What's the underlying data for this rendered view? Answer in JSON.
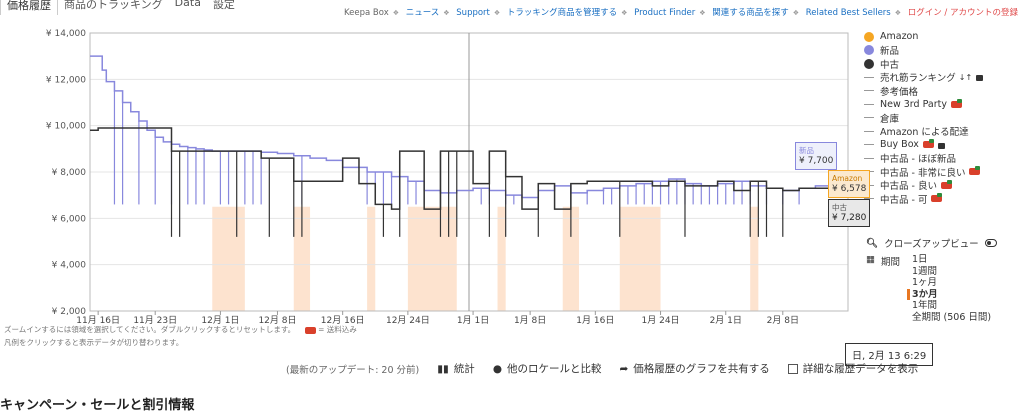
{
  "tabs": [
    "価格履歴",
    "商品のトラッキング",
    "Data",
    "設定"
  ],
  "toplinks": {
    "items": [
      "Keepa Box",
      "ニュース",
      "Support",
      "トラッキング商品を管理する",
      "Product Finder",
      "関連する商品を探す",
      "Related Best Sellers"
    ],
    "login": "ログイン / アカウントの登録"
  },
  "legend": {
    "amazon": "Amazon",
    "new": "新品",
    "used": "中古",
    "sales_rank": "売れ筋ランキング",
    "sales_rank_icon": "↓↑",
    "reference": "参考価格",
    "new3p": "New 3rd Party",
    "warehouse": "倉庫",
    "fba": "Amazon による配達",
    "buybox": "Buy Box",
    "used_like_new": "中古品 - ほぼ新品",
    "used_very_good": "中古品 - 非常に良い",
    "used_good": "中古品 - 良い",
    "used_acceptable": "中古品 - 可"
  },
  "closeup": {
    "label": "クローズアップビュー",
    "icon": "search-icon"
  },
  "period": {
    "label": "期間",
    "icon": "calendar-icon",
    "options": [
      "1日",
      "1週間",
      "1ヶ月",
      "3か月",
      "1年間",
      "全期間 (506 日間)"
    ],
    "selected": "3か月"
  },
  "notes": {
    "line1": "ズームインするには領域を選択してください。ダブルクリックするとリセットします。",
    "shipping": "= 送料込み",
    "line2": "凡例をクリックすると表示データが切り替わります。"
  },
  "hover_date": "日, 2月 13 6:29",
  "bottom": {
    "updated": "(最新のアップデート: 20 分前)",
    "stats": "統計",
    "compare": "他のロケールと比較",
    "share": "価格履歴のグラフを共有する",
    "details": "詳細な履歴データを表示"
  },
  "footer_title": "キャンペーン・セールと割引情報",
  "colors": {
    "amazon": "#f5a623",
    "new": "#8888dd",
    "used": "#333333",
    "buybox_band": "#fde3cf",
    "axis": "#bbbbbb"
  },
  "chart_data": {
    "type": "line",
    "ylim": [
      2000,
      14000
    ],
    "y_ticks": [
      "¥ 2,000",
      "¥ 4,000",
      "¥ 6,000",
      "¥ 8,000",
      "¥ 10,000",
      "¥ 12,000",
      "¥ 14,000"
    ],
    "y_tick_values": [
      2000,
      4000,
      6000,
      8000,
      10000,
      12000,
      14000
    ],
    "x_ticks": [
      "11月 16日",
      "11月 23日",
      "12月 1日",
      "12月 8日",
      "12月 16日",
      "12月 24日",
      "1月 1日",
      "1月 8日",
      "1月 16日",
      "1月 24日",
      "2月 1日",
      "2月 8日"
    ],
    "x_tick_values": [
      0,
      7,
      15,
      22,
      30,
      38,
      46,
      53,
      61,
      69,
      77,
      84
    ],
    "x_range": [
      -1,
      92
    ],
    "crosshair_x": 45.5,
    "series": [
      {
        "name": "新品",
        "color": "#8888dd",
        "x": [
          -1,
          0,
          0.5,
          1,
          2,
          3,
          4,
          5,
          6,
          7,
          8,
          9,
          10,
          11,
          12,
          13,
          14,
          16,
          18,
          20,
          22,
          24,
          26,
          28,
          30,
          33,
          36,
          38,
          40,
          42,
          44,
          46,
          48,
          50,
          52,
          54,
          56,
          58,
          60,
          62,
          64,
          66,
          68,
          70,
          72,
          74,
          76,
          78,
          80,
          82,
          84,
          86,
          88,
          90,
          92
        ],
        "y": [
          13000,
          13000,
          12400,
          11900,
          11500,
          11000,
          10600,
          10200,
          9800,
          9500,
          9300,
          9200,
          9100,
          9050,
          9000,
          8950,
          8900,
          8900,
          8900,
          8850,
          8800,
          8700,
          8600,
          8500,
          8200,
          8000,
          7800,
          7600,
          7200,
          7100,
          7200,
          7300,
          7200,
          7000,
          6900,
          7200,
          7400,
          7100,
          7200,
          7300,
          7400,
          7500,
          7600,
          7700,
          7500,
          7400,
          7500,
          7600,
          7400,
          7300,
          7200,
          7300,
          7400,
          7700,
          7700
        ],
        "spikes": [
          2,
          3,
          5,
          7,
          9,
          11,
          12,
          13,
          15,
          16,
          18,
          19,
          20,
          25,
          33,
          34,
          35,
          36,
          37,
          38,
          39,
          40,
          47,
          48,
          50,
          51,
          58,
          60,
          62,
          63,
          65,
          66,
          67,
          68,
          69,
          70,
          71,
          72,
          73,
          74,
          75,
          76,
          77,
          78,
          79,
          80,
          82,
          84,
          86
        ],
        "spike_low": 6600
      },
      {
        "name": "中古",
        "color": "#333333",
        "x": [
          -1,
          0,
          2,
          4,
          6,
          8,
          9,
          10,
          12,
          14,
          16,
          18,
          20,
          22,
          24,
          26,
          28,
          30,
          32,
          34,
          36,
          37,
          40,
          42,
          44,
          46,
          48,
          50,
          52,
          54,
          56,
          58,
          60,
          62,
          64,
          66,
          68,
          70,
          72,
          74,
          76,
          78,
          80,
          82,
          84,
          86,
          88,
          90,
          92
        ],
        "y": [
          9800,
          9900,
          9900,
          9900,
          9900,
          9900,
          8900,
          8900,
          8900,
          8900,
          8900,
          8900,
          8600,
          8600,
          7600,
          7600,
          7600,
          8600,
          7500,
          6600,
          6400,
          8900,
          6400,
          8900,
          8900,
          7500,
          8900,
          7800,
          6400,
          7500,
          6400,
          7500,
          7600,
          7600,
          7600,
          7600,
          7400,
          7600,
          7400,
          7400,
          7600,
          7200,
          7600,
          7300,
          7200,
          7300,
          7300,
          7300,
          7300
        ],
        "spikes": [
          9,
          10,
          17,
          21,
          24,
          25,
          35,
          37,
          42,
          43,
          44,
          48,
          50,
          54,
          58,
          64,
          72,
          80,
          81,
          82,
          84
        ],
        "spike_low": 5200
      }
    ],
    "buybox_bands": [
      [
        14,
        18
      ],
      [
        24,
        26
      ],
      [
        33,
        34
      ],
      [
        38,
        44
      ],
      [
        49,
        50
      ],
      [
        57,
        59
      ],
      [
        64,
        69
      ],
      [
        80,
        81
      ]
    ],
    "annotations": [
      {
        "label": "新品",
        "value": "¥ 7,700",
        "y": 7700
      },
      {
        "label": "Amazon",
        "value": "¥ 6,578",
        "y": 6578
      },
      {
        "label": "中古",
        "value": "¥ 7,280",
        "y": 7280
      }
    ]
  }
}
